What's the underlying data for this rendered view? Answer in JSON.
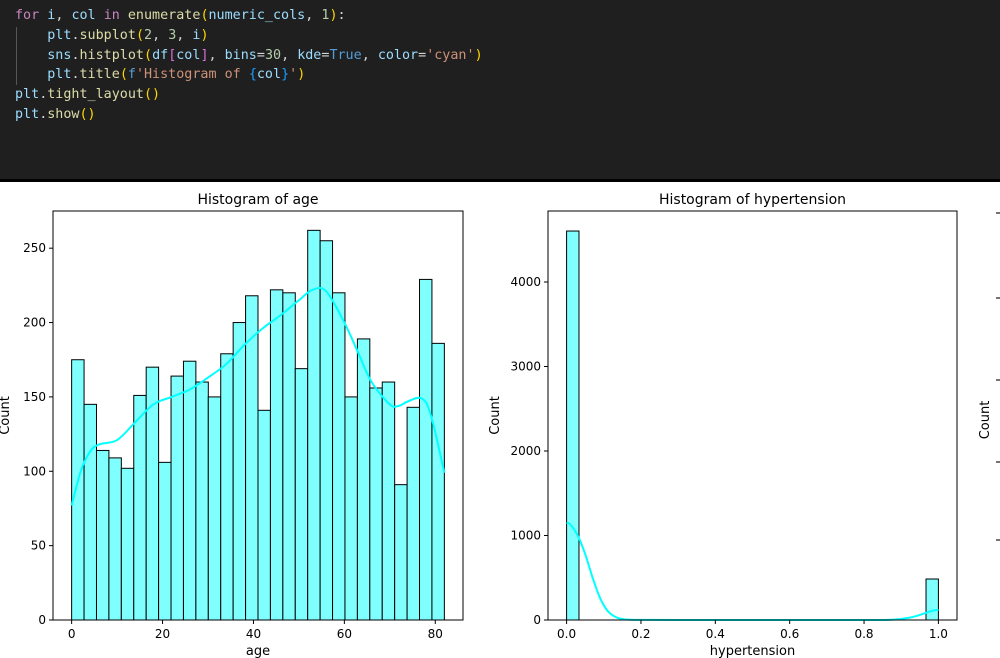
{
  "code_cell": {
    "lines": [
      [
        [
          "kw",
          "for"
        ],
        [
          "op",
          " "
        ],
        [
          "var",
          "i"
        ],
        [
          "op",
          ", "
        ],
        [
          "var",
          "col"
        ],
        [
          "op",
          " "
        ],
        [
          "kw",
          "in"
        ],
        [
          "op",
          " "
        ],
        [
          "fn",
          "enumerate"
        ],
        [
          "p1",
          "("
        ],
        [
          "var",
          "numeric_cols"
        ],
        [
          "op",
          ", "
        ],
        [
          "num",
          "1"
        ],
        [
          "p1",
          ")"
        ],
        [
          "op",
          ":"
        ]
      ],
      [
        [
          "op",
          "    "
        ],
        [
          "var",
          "plt"
        ],
        [
          "op",
          "."
        ],
        [
          "fn",
          "subplot"
        ],
        [
          "p1",
          "("
        ],
        [
          "num",
          "2"
        ],
        [
          "op",
          ", "
        ],
        [
          "num",
          "3"
        ],
        [
          "op",
          ", "
        ],
        [
          "var",
          "i"
        ],
        [
          "p1",
          ")"
        ]
      ],
      [
        [
          "op",
          "    "
        ],
        [
          "var",
          "sns"
        ],
        [
          "op",
          "."
        ],
        [
          "fn",
          "histplot"
        ],
        [
          "p1",
          "("
        ],
        [
          "var",
          "df"
        ],
        [
          "p2",
          "["
        ],
        [
          "var",
          "col"
        ],
        [
          "p2",
          "]"
        ],
        [
          "op",
          ", "
        ],
        [
          "var",
          "bins"
        ],
        [
          "op",
          "="
        ],
        [
          "num",
          "30"
        ],
        [
          "op",
          ", "
        ],
        [
          "var",
          "kde"
        ],
        [
          "op",
          "="
        ],
        [
          "const",
          "True"
        ],
        [
          "op",
          ", "
        ],
        [
          "var",
          "color"
        ],
        [
          "op",
          "="
        ],
        [
          "str",
          "'cyan'"
        ],
        [
          "p1",
          ")"
        ]
      ],
      [
        [
          "op",
          "    "
        ],
        [
          "var",
          "plt"
        ],
        [
          "op",
          "."
        ],
        [
          "fn",
          "title"
        ],
        [
          "p1",
          "("
        ],
        [
          "const",
          "f"
        ],
        [
          "str",
          "'Histogram of "
        ],
        [
          "p3",
          "{"
        ],
        [
          "var",
          "col"
        ],
        [
          "p3",
          "}"
        ],
        [
          "str",
          "'"
        ],
        [
          "p1",
          ")"
        ]
      ],
      [
        [
          "var",
          "plt"
        ],
        [
          "op",
          "."
        ],
        [
          "fn",
          "tight_layout"
        ],
        [
          "p1",
          "()"
        ]
      ],
      [
        [
          "var",
          "plt"
        ],
        [
          "op",
          "."
        ],
        [
          "fn",
          "show"
        ],
        [
          "p1",
          "()"
        ]
      ]
    ]
  },
  "colors": {
    "bar_fill": "#80ffff",
    "bar_edge": "#000000",
    "kde_line": "#00ffff",
    "cell_bg": "#1f1f1f"
  },
  "chart_data": [
    {
      "type": "bar",
      "title": "Histogram of age",
      "xlabel": "age",
      "ylabel": "Count",
      "bin_start": 0,
      "bin_end": 82,
      "bins": 30,
      "values": [
        175,
        145,
        114,
        109,
        102,
        151,
        170,
        106,
        164,
        174,
        160,
        150,
        179,
        200,
        218,
        141,
        222,
        220,
        169,
        262,
        255,
        220,
        150,
        189,
        156,
        160,
        91,
        143,
        229,
        186
      ],
      "kde": [
        [
          0,
          77
        ],
        [
          2,
          100
        ],
        [
          4,
          113
        ],
        [
          6,
          118
        ],
        [
          10,
          121
        ],
        [
          14,
          133
        ],
        [
          18,
          145
        ],
        [
          22,
          150
        ],
        [
          26,
          155
        ],
        [
          30,
          163
        ],
        [
          34,
          172
        ],
        [
          38,
          185
        ],
        [
          42,
          196
        ],
        [
          46,
          205
        ],
        [
          50,
          215
        ],
        [
          53,
          222
        ],
        [
          56,
          221
        ],
        [
          60,
          200
        ],
        [
          63,
          180
        ],
        [
          66,
          160
        ],
        [
          70,
          145
        ],
        [
          72,
          144
        ],
        [
          74,
          147
        ],
        [
          77,
          149
        ],
        [
          79,
          138
        ],
        [
          82,
          99
        ]
      ],
      "xlim": [
        -4.1,
        86.1
      ],
      "ylim": [
        0,
        275
      ],
      "xticks": [
        "0",
        "20",
        "40",
        "60",
        "80"
      ],
      "xtick_values": [
        0,
        20,
        40,
        60,
        80
      ],
      "yticks": [
        "0",
        "50",
        "100",
        "150",
        "200",
        "250"
      ],
      "ytick_values": [
        0,
        50,
        100,
        150,
        200,
        250
      ]
    },
    {
      "type": "bar",
      "title": "Histogram of hypertension",
      "xlabel": "hypertension",
      "ylabel": "Count",
      "bin_start": 0,
      "bin_end": 1,
      "bins": 30,
      "values": [
        4603,
        0,
        0,
        0,
        0,
        0,
        0,
        0,
        0,
        0,
        0,
        0,
        0,
        0,
        0,
        0,
        0,
        0,
        0,
        0,
        0,
        0,
        0,
        0,
        0,
        0,
        0,
        0,
        0,
        485
      ],
      "kde": [
        [
          0,
          1150
        ],
        [
          0.01,
          1130
        ],
        [
          0.03,
          1000
        ],
        [
          0.05,
          780
        ],
        [
          0.07,
          500
        ],
        [
          0.09,
          260
        ],
        [
          0.11,
          110
        ],
        [
          0.13,
          40
        ],
        [
          0.15,
          12
        ],
        [
          0.18,
          2
        ],
        [
          0.3,
          0
        ],
        [
          0.8,
          0
        ],
        [
          0.88,
          5
        ],
        [
          0.92,
          25
        ],
        [
          0.95,
          60
        ],
        [
          0.98,
          105
        ],
        [
          1.0,
          120
        ]
      ],
      "xlim": [
        -0.05,
        1.05
      ],
      "ylim": [
        0,
        4840
      ],
      "xticks": [
        "0.0",
        "0.2",
        "0.4",
        "0.6",
        "0.8",
        "1.0"
      ],
      "xtick_values": [
        0,
        0.2,
        0.4,
        0.6,
        0.8,
        1.0
      ],
      "yticks": [
        "0",
        "1000",
        "2000",
        "3000",
        "4000"
      ],
      "ytick_values": [
        0,
        1000,
        2000,
        3000,
        4000
      ]
    },
    {
      "type": "bar",
      "ylabel": "Count"
    }
  ]
}
